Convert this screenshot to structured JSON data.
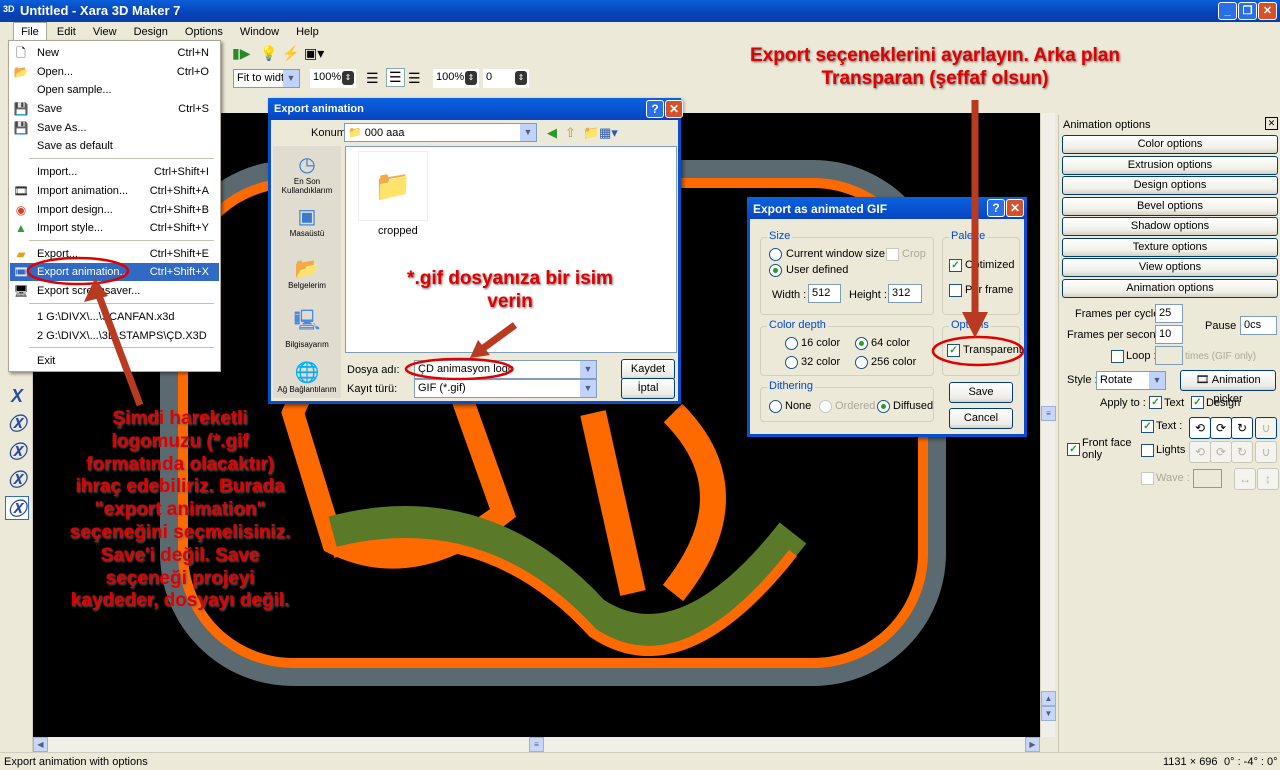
{
  "window": {
    "title": "Untitled - Xara 3D Maker 7",
    "app_icon": "3D"
  },
  "menubar": [
    "File",
    "Edit",
    "View",
    "Design",
    "Options",
    "Window",
    "Help"
  ],
  "toolbar": {
    "zoom_mode": "Fit to width",
    "zoom_percent": "100%",
    "text_scale": "100%",
    "line_spacing": "0"
  },
  "file_menu": {
    "items": [
      {
        "label": "New",
        "shortcut": "Ctrl+N",
        "icon": "new-document-icon"
      },
      {
        "label": "Open...",
        "shortcut": "Ctrl+O",
        "icon": "open-folder-icon"
      },
      {
        "label": "Open sample...",
        "shortcut": ""
      },
      {
        "label": "Save",
        "shortcut": "Ctrl+S",
        "icon": "floppy-disk-icon"
      },
      {
        "label": "Save As...",
        "shortcut": "",
        "icon": "save-as-icon"
      },
      {
        "label": "Save as default",
        "shortcut": ""
      },
      {
        "label": "Import...",
        "shortcut": "Ctrl+Shift+I"
      },
      {
        "label": "Import animation...",
        "shortcut": "Ctrl+Shift+A",
        "icon": "film-import-icon"
      },
      {
        "label": "Import design...",
        "shortcut": "Ctrl+Shift+B",
        "icon": "design-import-icon"
      },
      {
        "label": "Import style...",
        "shortcut": "Ctrl+Shift+Y",
        "icon": "style-import-icon"
      },
      {
        "label": "Export...",
        "shortcut": "Ctrl+Shift+E",
        "icon": "export-icon"
      },
      {
        "label": "Export animation...",
        "shortcut": "Ctrl+Shift+X",
        "icon": "film-export-icon",
        "highlighted": true
      },
      {
        "label": "Export screensaver...",
        "shortcut": "",
        "icon": "screensaver-icon"
      },
      {
        "label": "1 G:\\DIVX\\...\\SCANFAN.x3d",
        "shortcut": ""
      },
      {
        "label": "2 G:\\DIVX\\...\\3D STAMPS\\ÇD.X3D",
        "shortcut": ""
      },
      {
        "label": "Exit",
        "shortcut": ""
      }
    ]
  },
  "export_dialog": {
    "title": "Export animation",
    "location_label": "Konum:",
    "location": "000 aaa",
    "places": [
      "En Son Kullandıklarım",
      "Masaüstü",
      "Belgelerim",
      "Bilgisayarım",
      "Ağ Bağlantılarım"
    ],
    "files": [
      "cropped"
    ],
    "filename_label": "Dosya adı:",
    "filename": "ÇD animasyon logo",
    "filetype_label": "Kayıt türü:",
    "filetype": "GIF (*.gif)",
    "save_button": "Kaydet",
    "cancel_button": "İptal"
  },
  "gif_dialog": {
    "title": "Export as animated GIF",
    "size_group": "Size",
    "current_window_size": "Current window size",
    "crop": "Crop",
    "user_defined": "User defined",
    "width_label": "Width :",
    "width": "512",
    "height_label": "Height :",
    "height": "312",
    "palette_group": "Palette",
    "optimized": "Optimized",
    "per_frame": "Per frame",
    "color_depth_group": "Color depth",
    "c16": "16 color",
    "c64": "64 color",
    "c32": "32 color",
    "c256": "256 color",
    "options_group": "Options",
    "transparent": "Transparent",
    "dithering_group": "Dithering",
    "none": "None",
    "ordered": "Ordered",
    "diffused": "Diffused",
    "save": "Save",
    "cancel": "Cancel"
  },
  "right_panel": {
    "title": "Animation options",
    "sections": [
      "Color options",
      "Extrusion options",
      "Design options",
      "Bevel options",
      "Shadow options",
      "Texture options",
      "View options",
      "Animation options"
    ],
    "frames_per_cycle_label": "Frames per cycle :",
    "frames_per_cycle": "25",
    "frames_per_second_label": "Frames per second :",
    "frames_per_second": "10",
    "pause_label": "Pause :",
    "pause": "0cs",
    "loop_label": "Loop :",
    "loop_suffix": "times (GIF only)",
    "style_label": "Style :",
    "style": "Rotate",
    "animation_picker": "Animation picker",
    "apply_to_label": "Apply to :",
    "apply_text": "Text",
    "apply_design": "Design",
    "text_label": "Text :",
    "lights_label": "Lights :",
    "wave_label": "Wave :",
    "front_face_label": "Front face only"
  },
  "annotations": {
    "top": "Export seçeneklerini ayarlayın. Arka plan Transparan (şeffaf olsun)",
    "gif": "*.gif dosyanıza bir isim verin",
    "left": "Şimdi hareketli logomuzu (*.gif formatında olacaktır) ihraç edebiliriz. Burada \"export animation\" seçeneğini seçmelisiniz. Save'i değil. Save seçeneği projeyi kaydeder, dosyayı değil."
  },
  "statusbar": {
    "message": "Export animation with options",
    "dimensions": "1131 × 696",
    "angles": "0° : -4° : 0°"
  },
  "colors": {
    "annotation": "#e00000",
    "highlight": "#316ac5",
    "logo_orange": "#ff6a00",
    "logo_green": "#5a7a2a",
    "canvas": "#000000"
  }
}
